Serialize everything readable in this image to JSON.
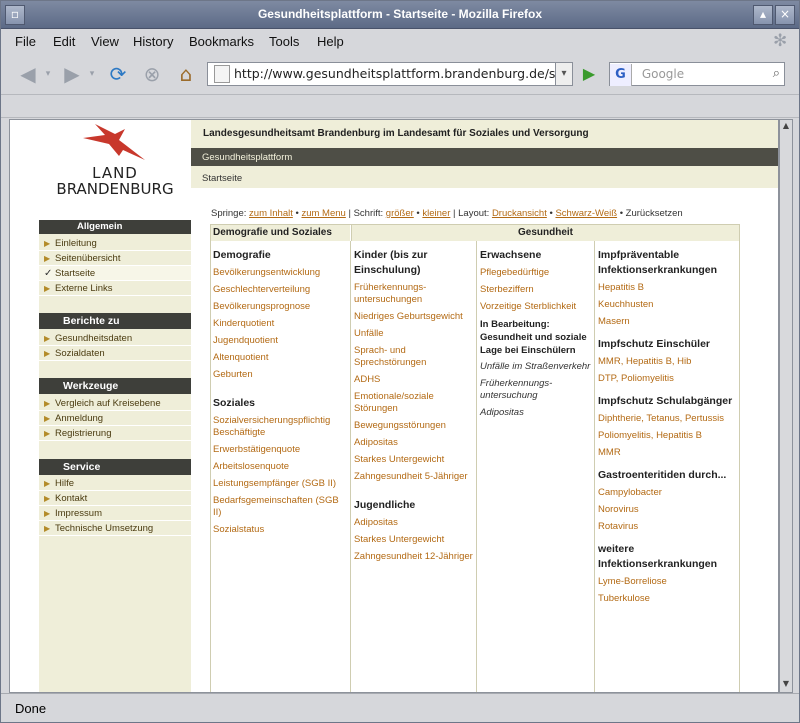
{
  "window": {
    "title": "Gesundheitsplattform - Startseite - Mozilla Firefox"
  },
  "menu": [
    "File",
    "Edit",
    "View",
    "History",
    "Bookmarks",
    "Tools",
    "Help"
  ],
  "nav": {
    "url": "http://www.gesundheitsplattform.brandenburg.de/sixcms",
    "search_placeholder": "Google"
  },
  "status": {
    "text": "Done"
  },
  "page": {
    "logo": {
      "line1": "LAND",
      "line2": "BRANDENBURG"
    },
    "header": {
      "agency": "Landesgesundheitsamt Brandenburg im Landesamt für Soziales und Versorgung",
      "platform": "Gesundheitsplattform",
      "crumb": "Startseite"
    },
    "springe": {
      "label": "Springe:",
      "zum_inhalt": "zum Inhalt",
      "zum_menu": "zum Menu",
      "schrift": "| Schrift:",
      "groesser": "größer",
      "kleiner": "kleiner",
      "layout": "| Layout:",
      "druck": "Druckansicht",
      "sw": "Schwarz-Weiß",
      "zurueck": "Zurücksetzen"
    },
    "sidebar": {
      "allgemein": {
        "title": "Allgemein",
        "items": [
          "Einleitung",
          "Seitenübersicht",
          "Startseite",
          "Externe Links"
        ]
      },
      "berichte": {
        "title": "Berichte zu",
        "items": [
          "Gesundheitsdaten",
          "Sozialdaten"
        ]
      },
      "werkzeuge": {
        "title": "Werkzeuge",
        "items": [
          "Vergleich auf Kreisebene",
          "Anmeldung",
          "Registrierung"
        ]
      },
      "service": {
        "title": "Service",
        "items": [
          "Hilfe",
          "Kontakt",
          "Impressum",
          "Technische Umsetzung"
        ]
      }
    },
    "table": {
      "h1": "Demografie und Soziales",
      "h2": "Gesundheit",
      "c1": {
        "demografie": "Demografie",
        "demo_items": [
          "Bevölkerungsentwicklung",
          "Geschlechterverteilung",
          "Bevölkerungsprognose",
          "Kinderquotient",
          "Jugendquotient",
          "Altenquotient",
          "Geburten"
        ],
        "soziales": "Soziales",
        "soz_items": [
          "Sozialversicherungspflichtig Beschäftigte",
          "Erwerbstätigenquote",
          "Arbeitslosenquote",
          "Leistungsempfänger (SGB II)",
          "Bedarfsgemeinschaften (SGB II)",
          "Sozialstatus"
        ]
      },
      "c2": {
        "kinder": "Kinder (bis zur Einschulung)",
        "kinder_items": [
          "Früherkennungs-untersuchungen",
          "Niedriges Geburtsgewicht",
          "Unfälle",
          "Sprach- und Sprechstörungen",
          "ADHS",
          "Emotionale/soziale Störungen",
          "Bewegungsstörungen",
          "Adipositas",
          "Starkes Untergewicht",
          "Zahngesundheit 5-Jähriger"
        ],
        "jugend": "Jugendliche",
        "jugend_items": [
          "Adipositas",
          "Starkes Untergewicht",
          "Zahngesundheit 12-Jähriger"
        ]
      },
      "c3": {
        "erw": "Erwachsene",
        "erw_items": [
          "Pflegebedürftige",
          "Sterbeziffern",
          "Vorzeitige Sterblichkeit"
        ],
        "inb": "In Bearbeitung: Gesundheit und soziale Lage bei Einschülern",
        "inb_items": [
          "Unfälle im Straßenverkehr",
          "Früherkennungs-untersuchung",
          "Adipositas"
        ]
      },
      "c4": {
        "impfprae": "Impfpräventable Infektionserkrankungen",
        "impfprae_items": [
          "Hepatitis B",
          "Keuchhusten",
          "Masern"
        ],
        "schueler": "Impfschutz Einschüler",
        "schueler_items": [
          "MMR, Hepatitis B, Hib",
          "DTP, Poliomyelitis"
        ],
        "abg": "Impfschutz Schulabgänger",
        "abg_items": [
          "Diphtherie, Tetanus, Pertussis",
          "Poliomyelitis, Hepatitis B",
          "MMR"
        ],
        "gastro": "Gastroenteritiden durch...",
        "gastro_items": [
          "Campylobacter",
          "Norovirus",
          "Rotavirus"
        ],
        "weitere": "weitere Infektionserkrankungen",
        "weitere_items": [
          "Lyme-Borreliose",
          "Tuberkulose"
        ]
      }
    }
  }
}
